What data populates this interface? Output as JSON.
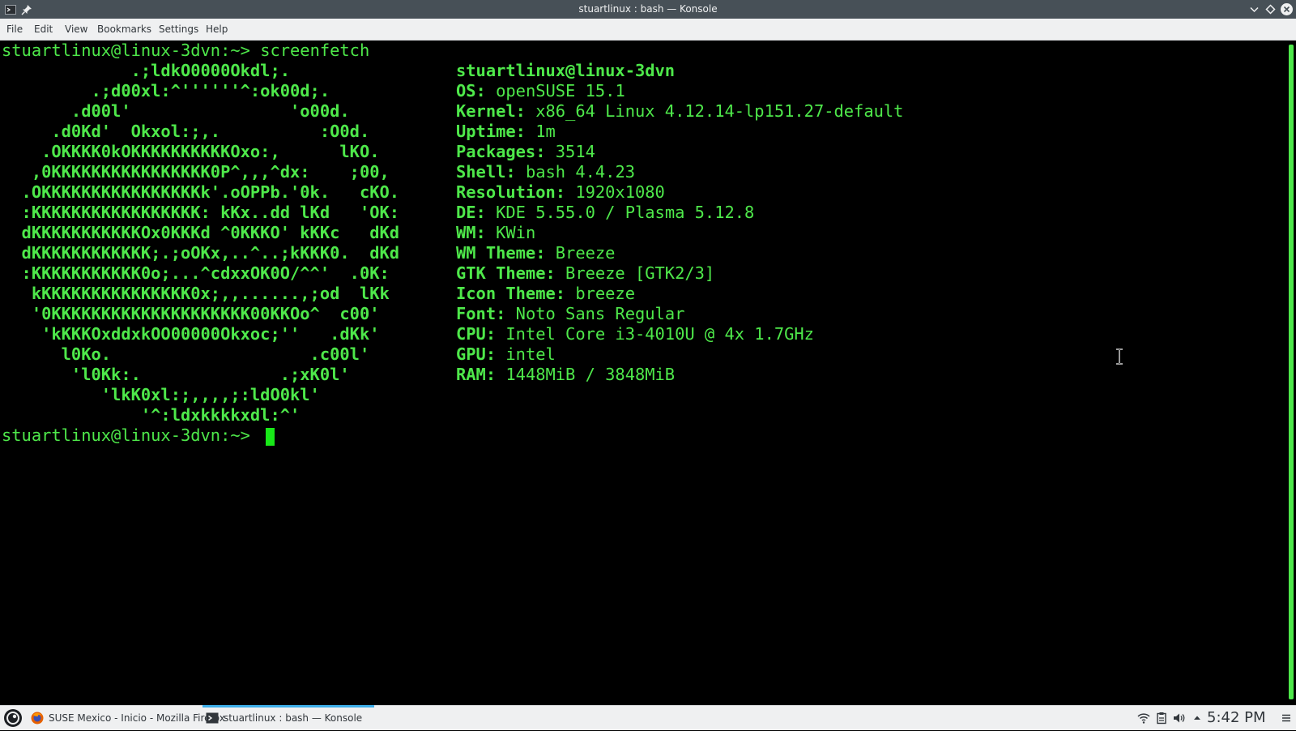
{
  "window": {
    "title": "stuartlinux : bash — Konsole"
  },
  "menubar": {
    "items": [
      "File",
      "Edit",
      "View",
      "Bookmarks",
      "Settings",
      "Help"
    ]
  },
  "terminal": {
    "prompt": "stuartlinux@linux-3dvn:~> ",
    "command": "screenfetch",
    "logo_lines": [
      "             .;ldkO0000Okdl;.",
      "         .;d00xl:^''''''^:ok00d;.",
      "       .d00l'                'o00d.",
      "     .d0Kd'  Okxol:;,.          :O0d.",
      "    .OKKKK0kOKKKKKKKKKKOxo:,      lKO.",
      "   ,0KKKKKKKKKKKKKKKK0P^,,,^dx:    ;00,",
      "  .OKKKKKKKKKKKKKKKKk'.oOPPb.'0k.   cKO.",
      "  :KKKKKKKKKKKKKKKKK: kKx..dd lKd   'OK:",
      "  dKKKKKKKKKKKOx0KKKd ^0KKKO' kKKc   dKd",
      "  dKKKKKKKKKKKK;.;oOKx,..^..;kKKK0.  dKd",
      "  :KKKKKKKKKKK0o;...^cdxxOK0O/^^'  .0K:",
      "   kKKKKKKKKKKKKKKK0x;,,......,;od  lKk",
      "   '0KKKKKKKKKKKKKKKKKKKK00KKOo^  c00'",
      "    'kKKKOxddxkOO00000Okxoc;''   .dKk'",
      "      l0Ko.                    .c00l'",
      "       'l0Kk:.              .;xK0l'",
      "          'lkK0xl:;,,,,;:ldO0kl'",
      "              '^:ldxkkkkxdl:^'"
    ],
    "user_host": "stuartlinux@linux-3dvn",
    "info": [
      {
        "label": "OS:",
        "value": "openSUSE 15.1"
      },
      {
        "label": "Kernel:",
        "value": "x86_64 Linux 4.12.14-lp151.27-default"
      },
      {
        "label": "Uptime:",
        "value": "1m"
      },
      {
        "label": "Packages:",
        "value": "3514"
      },
      {
        "label": "Shell:",
        "value": "bash 4.4.23"
      },
      {
        "label": "Resolution:",
        "value": "1920x1080"
      },
      {
        "label": "DE:",
        "value": "KDE 5.55.0 / Plasma 5.12.8"
      },
      {
        "label": "WM:",
        "value": "KWin"
      },
      {
        "label": "WM Theme:",
        "value": "Breeze"
      },
      {
        "label": "GTK Theme:",
        "value": "Breeze [GTK2/3]"
      },
      {
        "label": "Icon Theme:",
        "value": "breeze"
      },
      {
        "label": "Font:",
        "value": "Noto Sans Regular"
      },
      {
        "label": "CPU:",
        "value": "Intel Core i3-4010U @ 4x 1.7GHz"
      },
      {
        "label": "GPU:",
        "value": "intel"
      },
      {
        "label": "RAM:",
        "value": "1448MiB / 3848MiB"
      }
    ],
    "colors": {
      "foreground": "#4ee84a",
      "background": "#000000",
      "cursor": "#18e818"
    }
  },
  "taskbar": {
    "tasks": [
      {
        "label": "SUSE Mexico - Inicio - Mozilla Firefox",
        "icon": "firefox-icon"
      },
      {
        "label": "stuartlinux : bash — Konsole",
        "icon": "konsole-icon",
        "active": true
      }
    ],
    "tray_icons": [
      "wifi-icon",
      "clipboard-icon",
      "volume-icon",
      "tray-expand-icon"
    ],
    "clock": "5:42 PM",
    "accent": "#3daee9"
  }
}
